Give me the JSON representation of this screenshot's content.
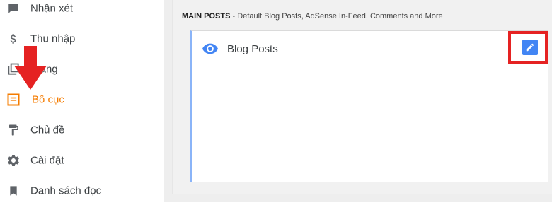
{
  "sidebar": {
    "items": [
      {
        "label": "Nhận xét",
        "icon": "comment-icon",
        "active": false
      },
      {
        "label": "Thu nhập",
        "icon": "dollar-icon",
        "active": false
      },
      {
        "label": "Trang",
        "icon": "pages-icon",
        "active": false
      },
      {
        "label": "Bố cục",
        "icon": "layout-icon",
        "active": true
      },
      {
        "label": "Chủ đề",
        "icon": "paint-roller-icon",
        "active": false
      },
      {
        "label": "Cài đặt",
        "icon": "gear-icon",
        "active": false
      },
      {
        "label": "Danh sách đọc",
        "icon": "bookmark-icon",
        "active": false
      }
    ]
  },
  "main": {
    "section": {
      "title": "MAIN POSTS",
      "subtitle": " - Default Blog Posts, AdSense In-Feed, Comments and More"
    },
    "widget": {
      "title": "Blog Posts",
      "icon": "eye-icon",
      "edit_icon": "pencil-icon"
    }
  },
  "colors": {
    "active": "#f57c00",
    "icon": "#5f6368",
    "accent": "#4285f4",
    "annotation": "#e52222"
  },
  "annotations": {
    "arrow": "red-down-arrow",
    "box": "red-highlight-box"
  }
}
